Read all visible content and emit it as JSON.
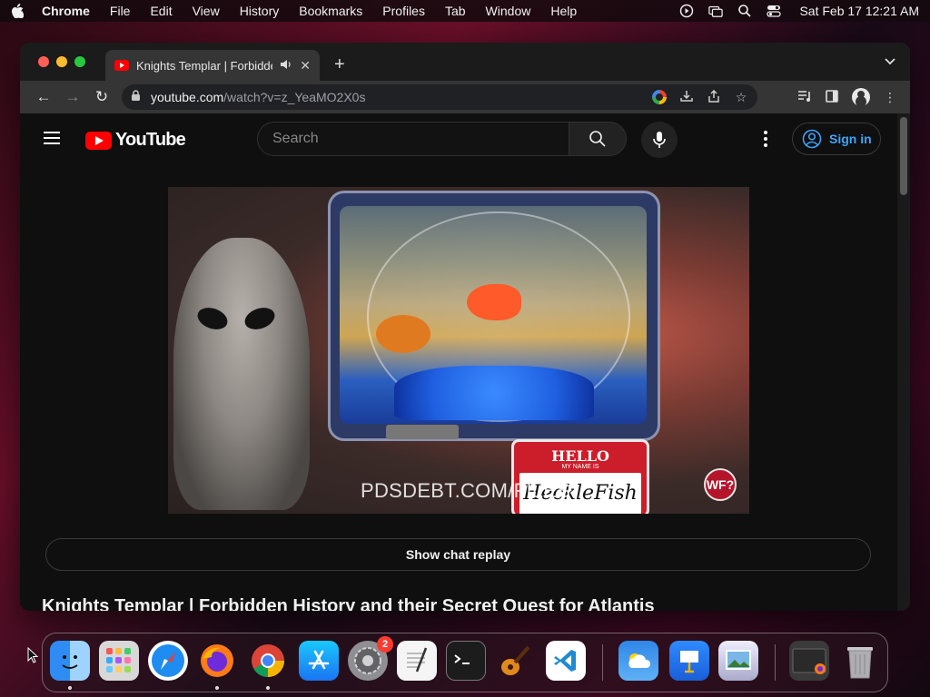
{
  "menubar": {
    "app_name": "Chrome",
    "items": [
      "File",
      "Edit",
      "View",
      "History",
      "Bookmarks",
      "Profiles",
      "Tab",
      "Window",
      "Help"
    ],
    "clock": "Sat Feb 17  12:21 AM"
  },
  "browser": {
    "tab_title": "Knights Templar | Forbidde",
    "new_tab": "+",
    "url_host": "youtube.com",
    "url_path": "/watch?v=z_YeaMO2X0s"
  },
  "youtube": {
    "logo_text": "YouTube",
    "search_placeholder": "Search",
    "sign_in": "Sign in",
    "video_overlay_text": "PDSDEBT.COM/FILES",
    "video_badge": "WF?",
    "nametag_hello": "HELLO",
    "nametag_my_name_is": "MY NAME IS",
    "nametag_name": "HeckleFish",
    "chat_replay_label": "Show chat replay",
    "video_title": "Knights Templar | Forbidden History and their Secret Quest for Atlantis"
  },
  "dock": {
    "items": [
      {
        "name": "finder",
        "running": true
      },
      {
        "name": "launchpad",
        "running": false
      },
      {
        "name": "safari",
        "running": false
      },
      {
        "name": "firefox",
        "running": true
      },
      {
        "name": "chrome",
        "running": true
      },
      {
        "name": "app-store",
        "running": false
      },
      {
        "name": "system-settings",
        "running": false,
        "badge": "2"
      },
      {
        "name": "textedit",
        "running": false
      },
      {
        "name": "terminal",
        "running": false
      },
      {
        "name": "garageband",
        "running": false
      },
      {
        "name": "vscode",
        "running": false
      },
      {
        "name": "weather",
        "running": false
      },
      {
        "name": "keynote",
        "running": false
      },
      {
        "name": "preview",
        "running": false
      },
      {
        "name": "downloads-stack",
        "running": false
      },
      {
        "name": "trash",
        "running": false
      }
    ]
  },
  "colors": {
    "youtube_red": "#ff0000",
    "signin_blue": "#3ea6ff",
    "page_bg": "#0f0f0f"
  }
}
